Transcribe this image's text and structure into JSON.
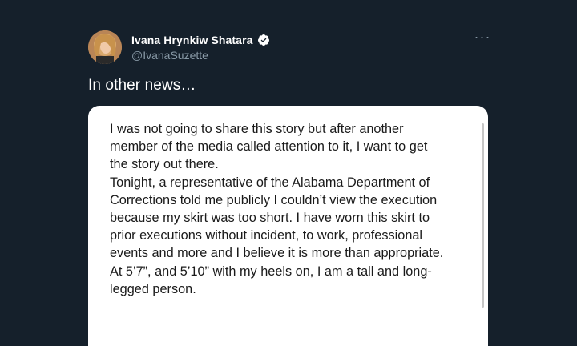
{
  "tweet": {
    "author": {
      "display_name": "Ivana Hrynkiw Shatara",
      "handle": "@IvanaSuzette",
      "verified": true,
      "avatar_icon": "profile-photo"
    },
    "more_icon": "more-horizontal-icon",
    "text": "In other news…",
    "media": {
      "lines": [
        "I was not going to share this story but after another",
        "member of the media called attention to it, I want to get",
        "the story out there.",
        "Tonight, a representative of the Alabama Department of",
        "Corrections told me publicly I couldn’t view the execution",
        "because my skirt was too short. I have worn this skirt to",
        "prior executions without incident, to work, professional",
        "events and more and I believe it is more than appropriate.",
        "At 5’7”, and 5’10” with my heels on, I am a tall and long-",
        "legged person."
      ]
    }
  },
  "colors": {
    "background": "#15202b",
    "secondary_text": "#8899a6",
    "verified_badge": "#ffffff"
  }
}
